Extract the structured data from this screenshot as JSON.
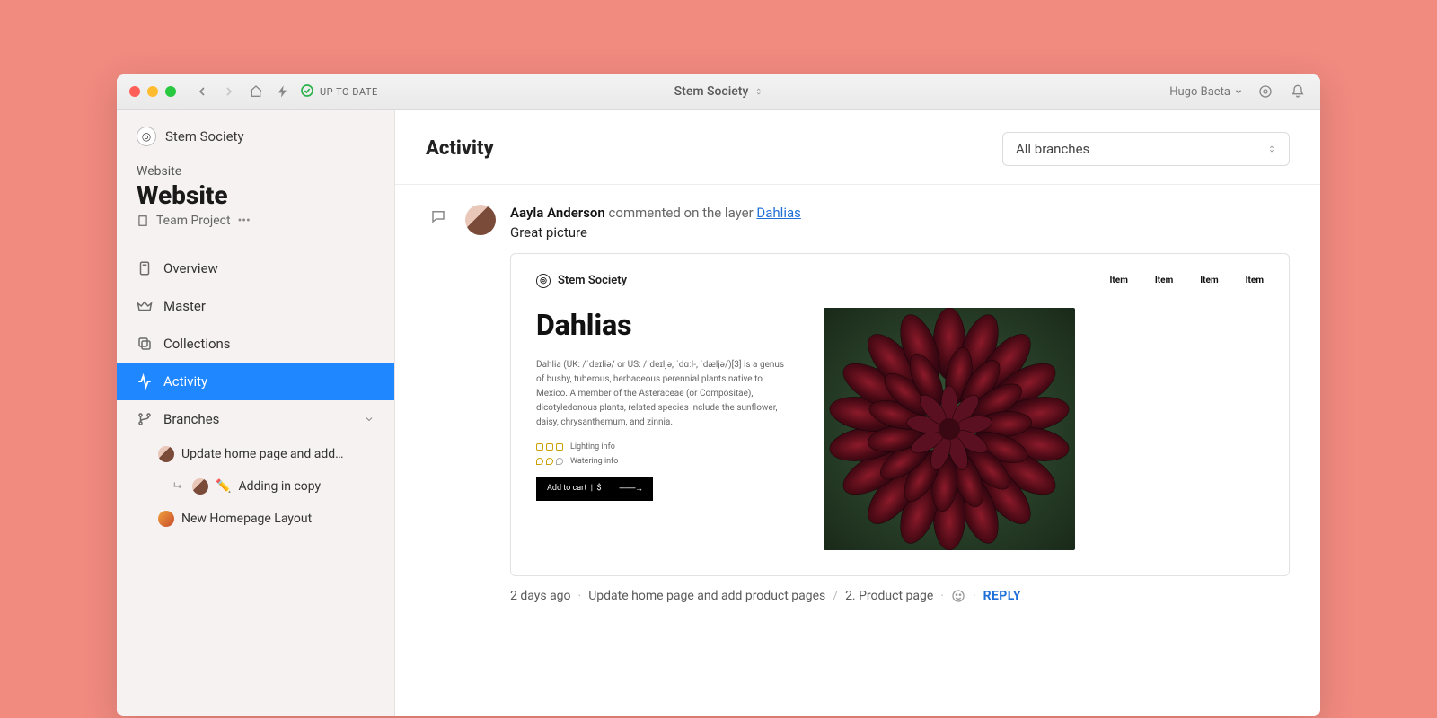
{
  "titlebar": {
    "sync_status": "UP TO DATE",
    "project_title": "Stem Society",
    "user_name": "Hugo Baeta"
  },
  "sidebar": {
    "org_name": "Stem Society",
    "breadcrumb": "Website",
    "current_title": "Website",
    "project_kind": "Team Project",
    "nav": {
      "overview": "Overview",
      "master": "Master",
      "collections": "Collections",
      "activity": "Activity",
      "branches": "Branches"
    },
    "branches": [
      {
        "label": "Update home page and add…"
      },
      {
        "label": "Adding in copy",
        "emoji": "✏️",
        "sub": true
      },
      {
        "label": "New Homepage Layout"
      }
    ]
  },
  "main": {
    "title": "Activity",
    "filter_label": "All branches"
  },
  "feed": {
    "actor": "Aayla Anderson",
    "action": "commented on the layer",
    "target": "Dahlias",
    "body": "Great picture",
    "timestamp": "2 days ago",
    "branch": "Update home page and add product pages",
    "page": "2. Product page",
    "reply_label": "REPLY"
  },
  "preview": {
    "brand": "Stem Society",
    "nav_item": "Item",
    "title": "Dahlias",
    "description": "Dahlia (UK: /ˈdeɪliə/ or US: /ˈdeɪljə, ˈdɑːl-, ˈdæljə/)[3] is a genus of bushy, tuberous, herbaceous perennial plants native to Mexico. A member of the Asteraceae (or Compositae), dicotyledonous plants, related species include the sunflower, daisy, chrysanthemum, and zinnia.",
    "lighting": "Lighting info",
    "watering": "Watering info",
    "cart_label": "Add to cart",
    "cart_price": "$"
  }
}
